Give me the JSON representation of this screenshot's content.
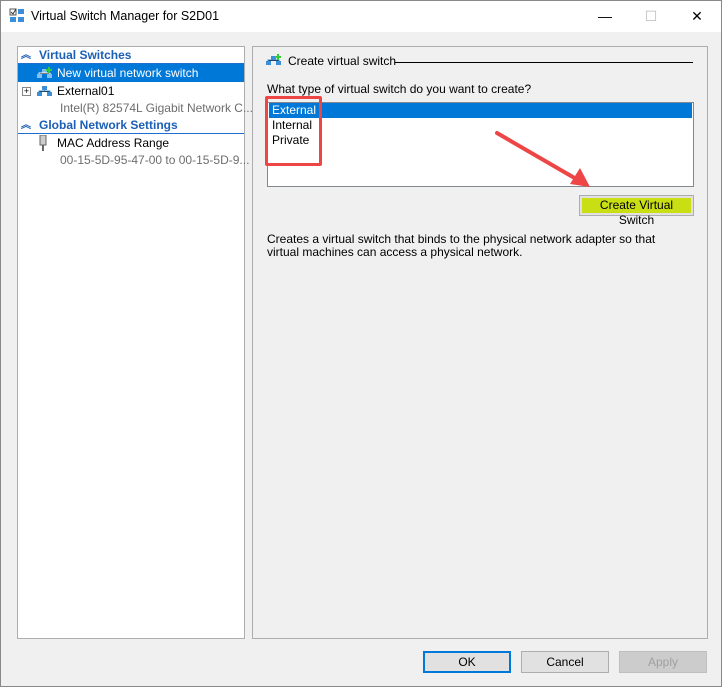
{
  "window": {
    "title": "Virtual Switch Manager for S2D01",
    "minimize": "—",
    "maximize": "☐",
    "close": "✕"
  },
  "sidebar": {
    "virtual_switches_header": "Virtual Switches",
    "new_switch": "New virtual network switch",
    "external": {
      "name": "External01",
      "detail": "Intel(R) 82574L Gigabit Network C..."
    },
    "global_header": "Global Network Settings",
    "mac": {
      "name": "MAC Address Range",
      "detail": "00-15-5D-95-47-00 to 00-15-5D-9..."
    }
  },
  "main": {
    "section_title": "Create virtual switch",
    "question": "What type of virtual switch do you want to create?",
    "options": [
      "External",
      "Internal",
      "Private"
    ],
    "selected": "External",
    "create_button": "Create Virtual Switch",
    "description": "Creates a virtual switch that binds to the physical network adapter so that virtual machines can access a physical network."
  },
  "footer": {
    "ok": "OK",
    "cancel": "Cancel",
    "apply": "Apply"
  },
  "colors": {
    "selection": "#0078d7",
    "highlight": "#c9df13",
    "annotation": "#ee4545"
  }
}
